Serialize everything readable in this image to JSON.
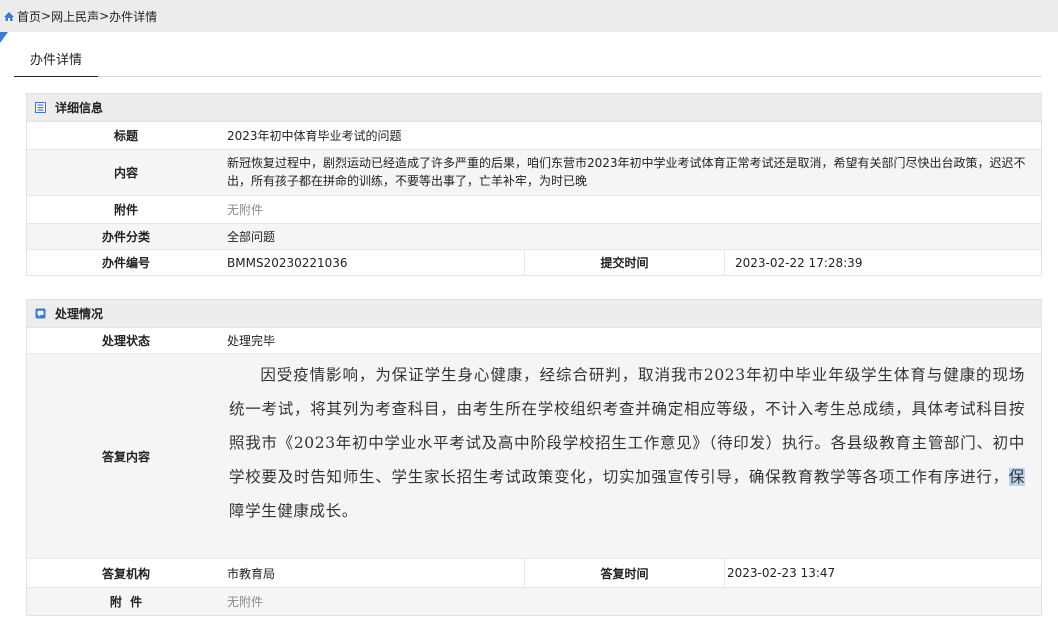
{
  "breadcrumb": {
    "home": "首页",
    "sep": ">",
    "section": "网上民声",
    "current": "办件详情"
  },
  "tab": {
    "label": "办件详情"
  },
  "detail": {
    "header": "详细信息",
    "title_label": "标题",
    "title_value": "2023年初中体育毕业考试的问题",
    "content_label": "内容",
    "content_value": "新冠恢复过程中，剧烈运动已经造成了许多严重的后果，咱们东营市2023年初中学业考试体育正常考试还是取消，希望有关部门尽快出台政策，迟迟不出，所有孩子都在拼命的训练，不要等出事了，亡羊补牢，为时已晚",
    "attachment_label": "附件",
    "attachment_value": "无附件",
    "category_label": "办件分类",
    "category_value": "全部问题",
    "number_label": "办件编号",
    "number_value": "BMMS20230221036",
    "submit_label": "提交时间",
    "submit_value": "2023-02-22 17:28:39"
  },
  "handling": {
    "header": "处理情况",
    "status_label": "处理状态",
    "status_value": "处理完毕",
    "reply_label": "答复内容",
    "reply_part1": "因受疫情影响，为保证学生身心健康，经综合研判，取消我市2023年初中毕业年级学生体育与健康的现场统一考试，将其列为考查科目，由考生所在学校组织考查并确定相应等级，不计入考生总成绩，具体考试科目按照我市《2023年初中学业水平考试及高中阶段学校招生工作意见》（待印发）执行。各县级教育主管部门、初中学校要及时告知师生、学生家长招生考试政策变化，切实加强宣传引导，确保教育教学等各项工作有序进行，",
    "reply_highlight": "保",
    "reply_part2": "障学生健康成长。",
    "org_label": "答复机构",
    "org_value": "市教育局",
    "time_label": "答复时间",
    "time_value": "2023-02-23 13:47",
    "attachment_label": "附  件",
    "attachment_value": "无附件"
  },
  "colors": {
    "accent": "#3b7bcf",
    "header_bg": "#ededed",
    "alt_row": "#f5f5f5",
    "muted": "#8a8a8a",
    "highlight": "#bcd2f0"
  },
  "icons": {
    "home": "home-icon",
    "detail": "document-icon",
    "handling": "chat-icon"
  }
}
